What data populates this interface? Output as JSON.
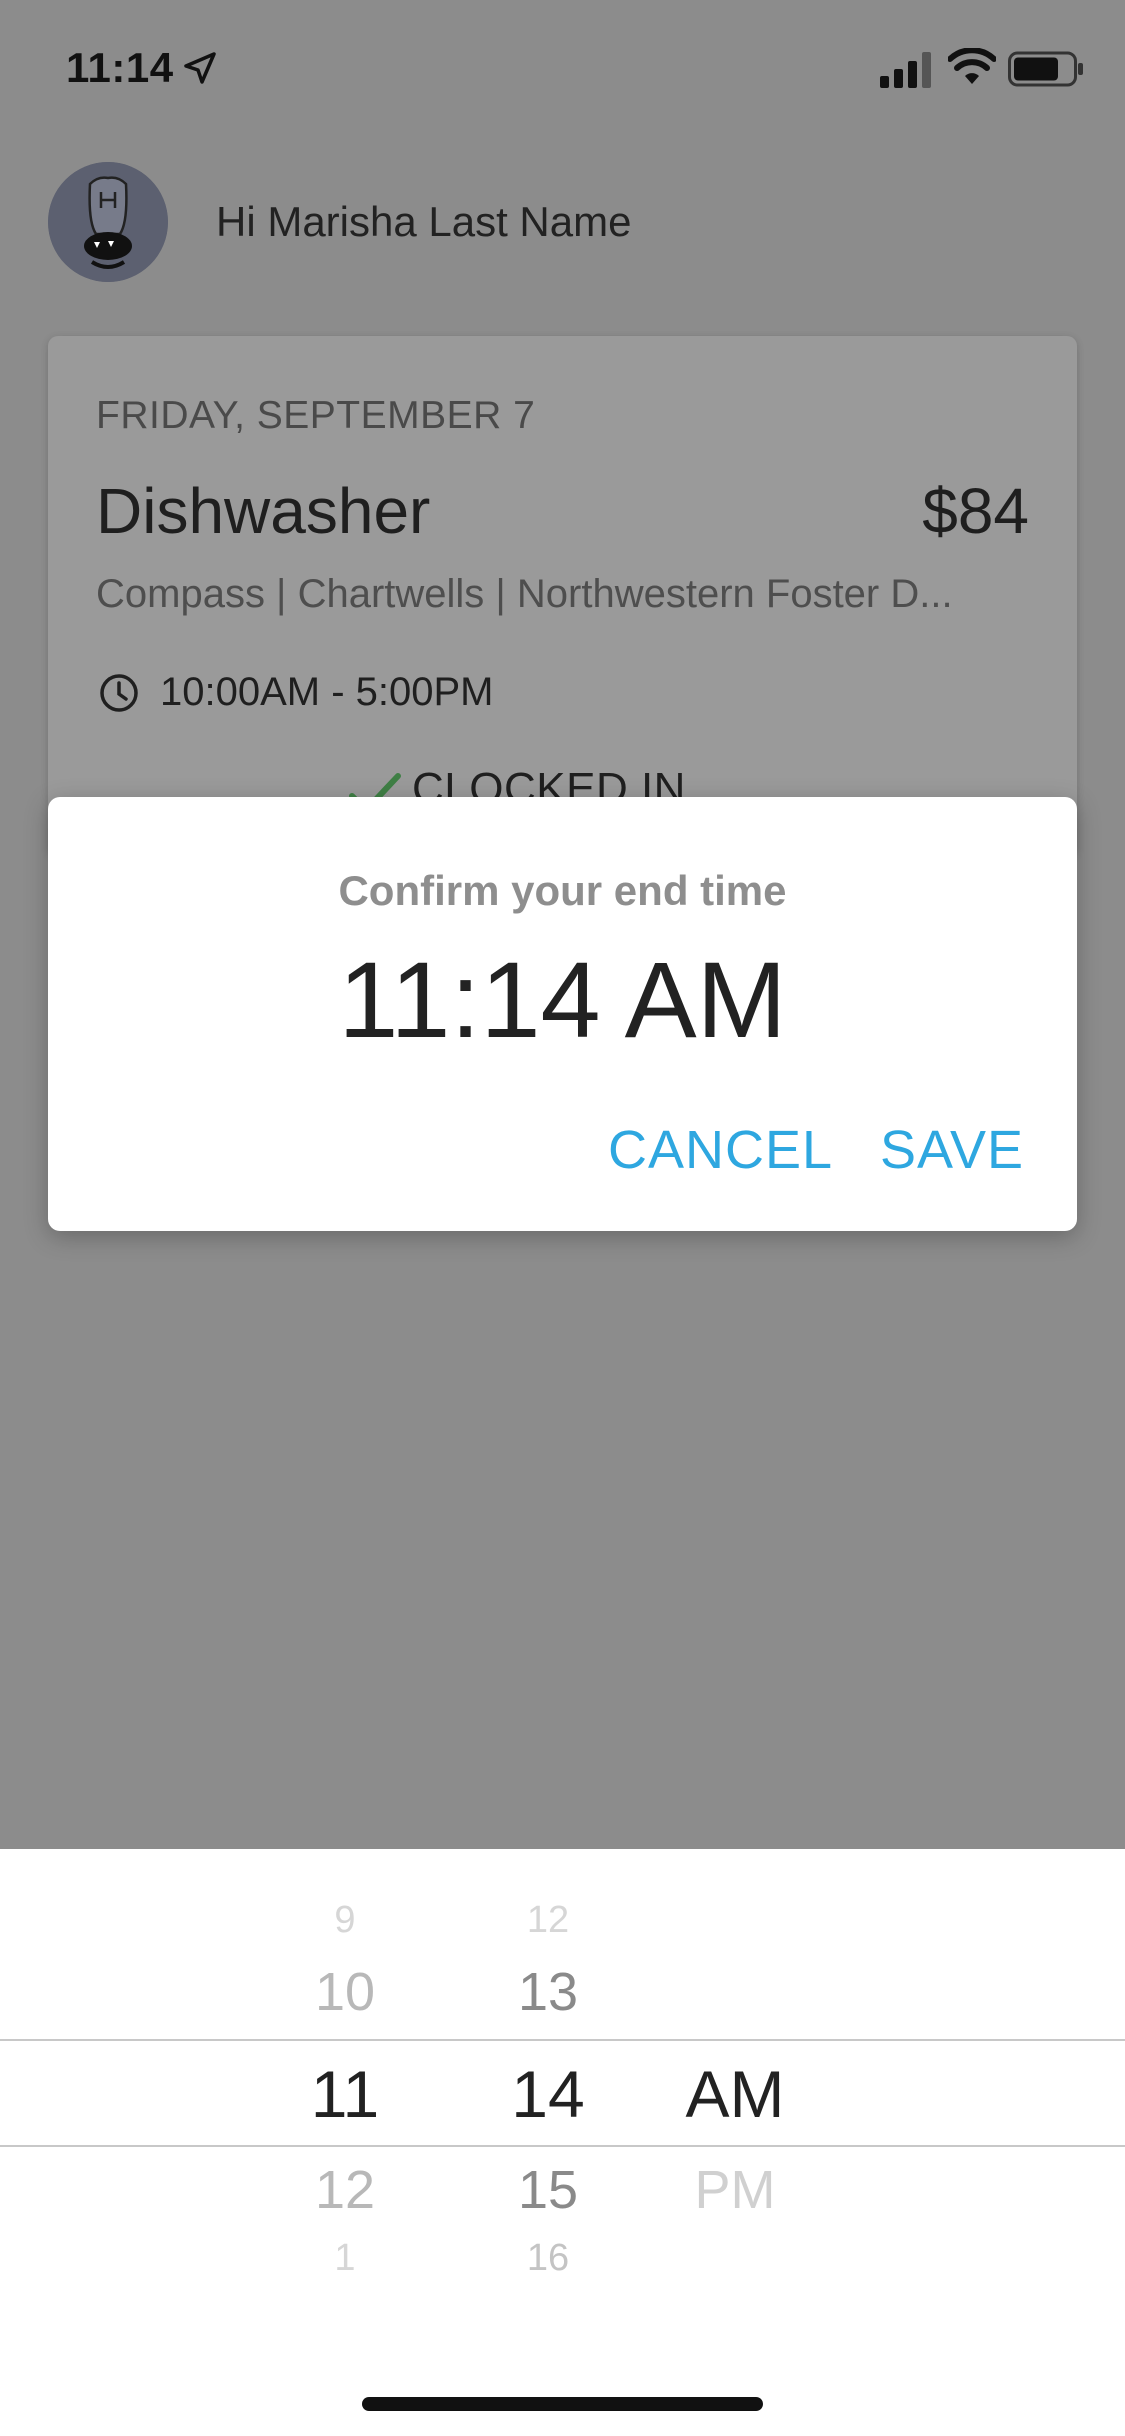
{
  "status_bar": {
    "time": "11:14",
    "icons": [
      "location-arrow-icon",
      "cellular-signal-icon",
      "wifi-icon",
      "battery-icon"
    ]
  },
  "header": {
    "greeting": "Hi Marisha Last Name",
    "avatar": "avatar-monster"
  },
  "shift": {
    "date": "FRIDAY, SEPTEMBER 7",
    "role": "Dishwasher",
    "pay": "$84",
    "location": "Compass | Chartwells | Northwestern Foster D...",
    "hours": "10:00AM - 5:00PM",
    "status": "CLOCKED IN"
  },
  "dialog": {
    "title": "Confirm your end time",
    "time": "11:14 AM",
    "cancel_label": "CANCEL",
    "save_label": "SAVE"
  },
  "picker": {
    "hours": [
      "9",
      "10",
      "11",
      "12",
      "1"
    ],
    "minutes": [
      "12",
      "13",
      "14",
      "15",
      "16"
    ],
    "periods": [
      "AM",
      "PM"
    ],
    "selected": {
      "hour": "11",
      "minute": "14",
      "period": "AM"
    }
  },
  "colors": {
    "accent": "#2ea7e0",
    "overlay": "#8c8c8c",
    "success": "#4caf50"
  }
}
